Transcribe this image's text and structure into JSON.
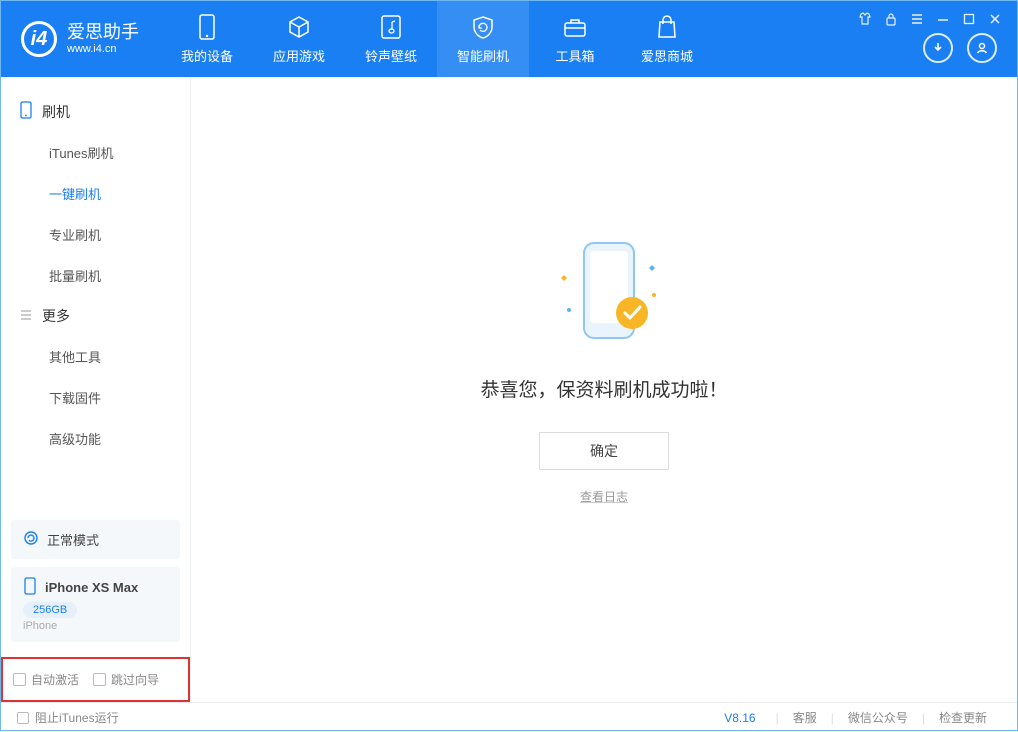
{
  "app": {
    "name_cn": "爱思助手",
    "name_en": "www.i4.cn"
  },
  "nav": {
    "items": [
      {
        "label": "我的设备"
      },
      {
        "label": "应用游戏"
      },
      {
        "label": "铃声壁纸"
      },
      {
        "label": "智能刷机"
      },
      {
        "label": "工具箱"
      },
      {
        "label": "爱思商城"
      }
    ]
  },
  "sidebar": {
    "group1_title": "刷机",
    "group1_items": [
      {
        "label": "iTunes刷机"
      },
      {
        "label": "一键刷机"
      },
      {
        "label": "专业刷机"
      },
      {
        "label": "批量刷机"
      }
    ],
    "group2_title": "更多",
    "group2_items": [
      {
        "label": "其他工具"
      },
      {
        "label": "下载固件"
      },
      {
        "label": "高级功能"
      }
    ],
    "mode_label": "正常模式",
    "device": {
      "name": "iPhone XS Max",
      "capacity": "256GB",
      "type": "iPhone"
    },
    "check1": "自动激活",
    "check2": "跳过向导"
  },
  "main": {
    "success_message": "恭喜您，保资料刷机成功啦！",
    "ok_button": "确定",
    "view_log": "查看日志"
  },
  "footer": {
    "block_itunes": "阻止iTunes运行",
    "version": "V8.16",
    "link1": "客服",
    "link2": "微信公众号",
    "link3": "检查更新"
  }
}
